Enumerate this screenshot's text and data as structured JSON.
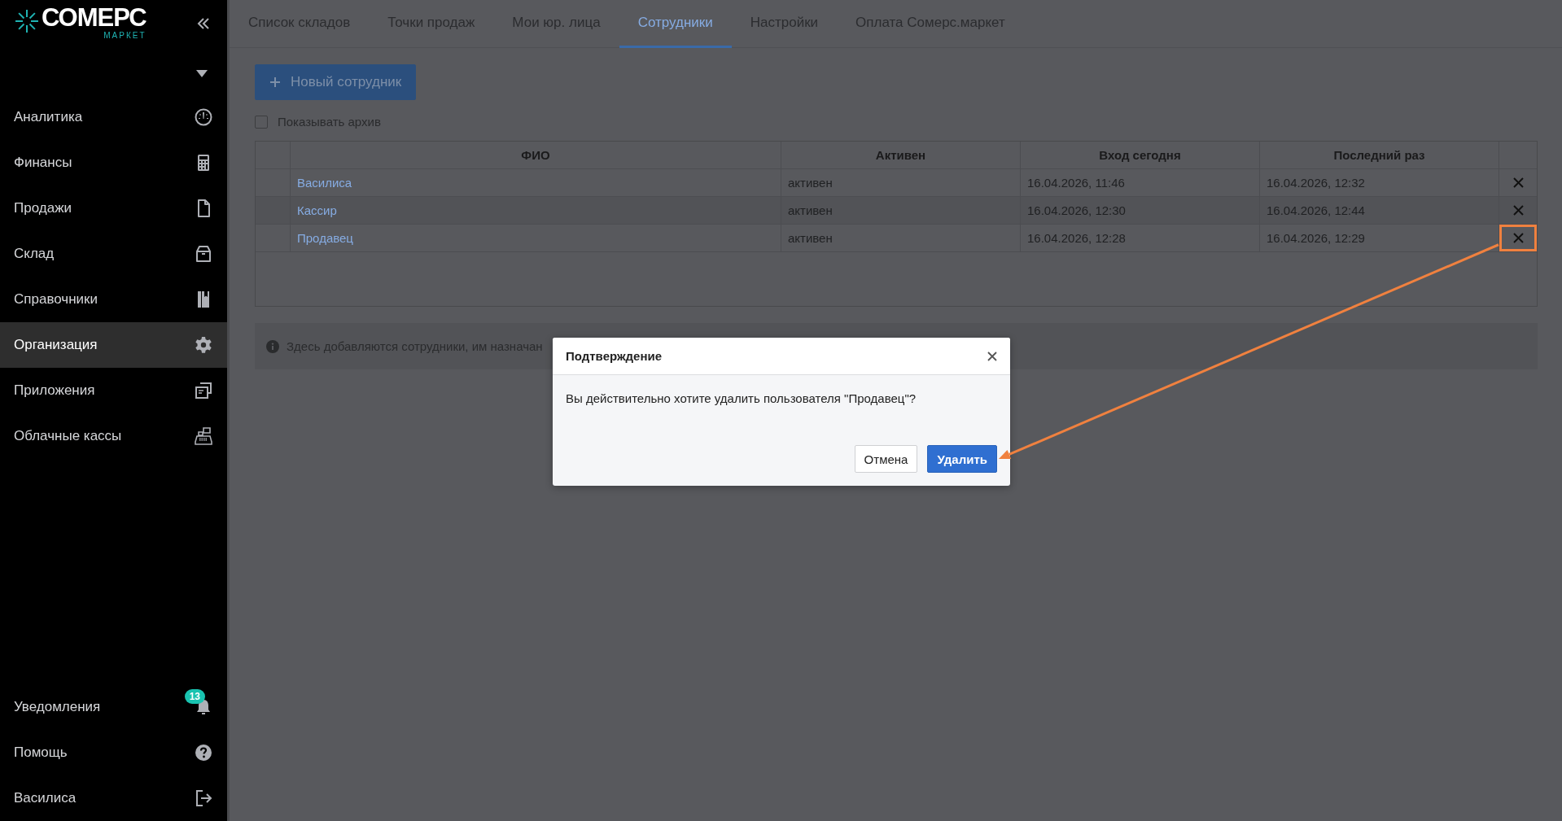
{
  "sidebar": {
    "logo": {
      "name": "СОМЕРС",
      "subtitle": "МАРКЕТ"
    },
    "items": [
      {
        "label": "Аналитика",
        "selected": false
      },
      {
        "label": "Финансы",
        "selected": false
      },
      {
        "label": "Продажи",
        "selected": false
      },
      {
        "label": "Склад",
        "selected": false
      },
      {
        "label": "Справочники",
        "selected": false
      },
      {
        "label": "Организация",
        "selected": true
      },
      {
        "label": "Приложения",
        "selected": false
      },
      {
        "label": "Облачные кассы",
        "selected": false
      }
    ],
    "bottom_items": [
      {
        "label": "Уведомления",
        "badge": "13"
      },
      {
        "label": "Помощь"
      },
      {
        "label": "Василиса"
      }
    ]
  },
  "tabs": [
    {
      "label": "Список складов",
      "selected": false
    },
    {
      "label": "Точки продаж",
      "selected": false
    },
    {
      "label": "Мои юр. лица",
      "selected": false
    },
    {
      "label": "Сотрудники",
      "selected": true
    },
    {
      "label": "Настройки",
      "selected": false
    },
    {
      "label": "Оплата Сомерс.маркет",
      "selected": false
    }
  ],
  "new_button": {
    "label": "Новый сотрудник"
  },
  "archive_checkbox": {
    "label": "Показывать архив",
    "checked": false
  },
  "table": {
    "columns": [
      "ФИО",
      "Активен",
      "Вход сегодня",
      "Последний раз"
    ],
    "rows": [
      {
        "name": "Василиса",
        "status": "активен",
        "login_today": "16.04.2026, 11:46",
        "last_seen": "16.04.2026, 12:32",
        "highlighted": false
      },
      {
        "name": "Кассир",
        "status": "активен",
        "login_today": "16.04.2026, 12:30",
        "last_seen": "16.04.2026, 12:44",
        "highlighted": false
      },
      {
        "name": "Продавец",
        "status": "активен",
        "login_today": "16.04.2026, 12:28",
        "last_seen": "16.04.2026, 12:29",
        "highlighted": true
      }
    ]
  },
  "info": {
    "text": "Здесь добавляются сотрудники, им назначан"
  },
  "dialog": {
    "title": "Подтверждение",
    "message": "Вы действительно хотите удалить пользователя \"Продавец\"?",
    "buttons": [
      {
        "label": "Отмена",
        "kind": "secondary"
      },
      {
        "label": "Удалить",
        "kind": "primary"
      }
    ]
  }
}
